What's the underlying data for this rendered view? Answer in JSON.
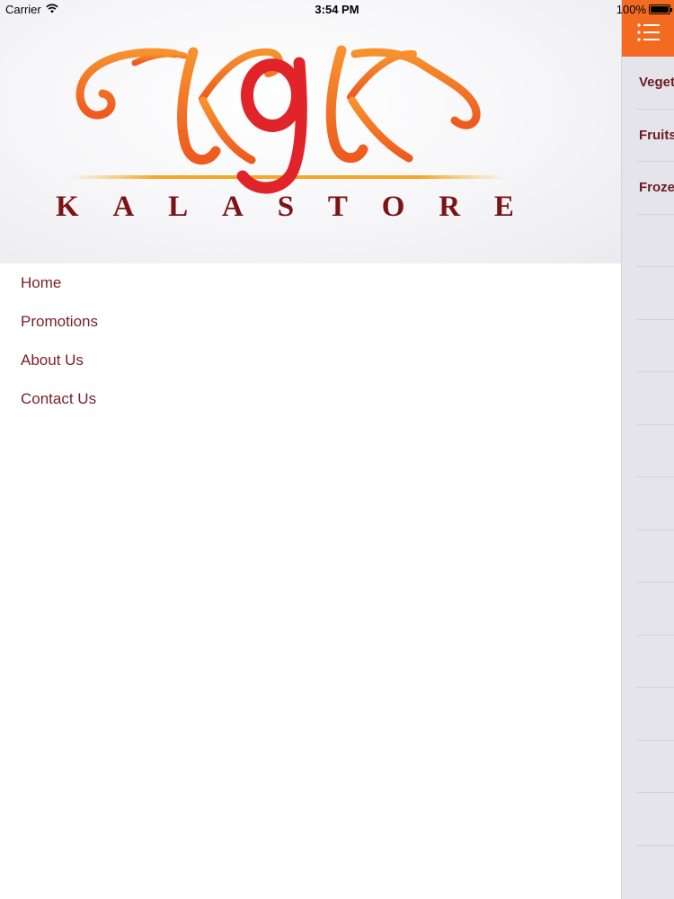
{
  "status_bar": {
    "carrier": "Carrier",
    "time": "3:54 PM",
    "battery": "100%",
    "battery_level": 1.0
  },
  "logo": {
    "icon": "kga-monogram-logo",
    "monogram": "KgK",
    "wordmark": "KALASTORE"
  },
  "menu": {
    "items": [
      {
        "label": "Home"
      },
      {
        "label": "Promotions"
      },
      {
        "label": "About Us"
      },
      {
        "label": "Contact Us"
      }
    ]
  },
  "content": {
    "nav_icon": "list-menu-icon",
    "categories": [
      {
        "label": "Vegetables"
      },
      {
        "label": "Fruits"
      },
      {
        "label": "Frozen"
      }
    ]
  },
  "colors": {
    "accent": "#f26b21",
    "menu_text": "#7a1d28",
    "wordmark": "#7a1416",
    "monogram_red": "#e0242a",
    "monogram_orange": "#f26b21"
  }
}
